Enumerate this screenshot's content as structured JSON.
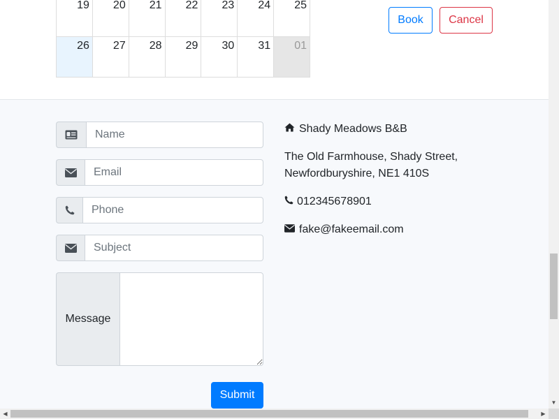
{
  "calendar": {
    "rows": [
      [
        {
          "day": "19",
          "state": "normal"
        },
        {
          "day": "20",
          "state": "normal"
        },
        {
          "day": "21",
          "state": "normal"
        },
        {
          "day": "22",
          "state": "normal"
        },
        {
          "day": "23",
          "state": "normal"
        },
        {
          "day": "24",
          "state": "normal"
        },
        {
          "day": "25",
          "state": "normal"
        }
      ],
      [
        {
          "day": "26",
          "state": "selected"
        },
        {
          "day": "27",
          "state": "normal"
        },
        {
          "day": "28",
          "state": "normal"
        },
        {
          "day": "29",
          "state": "normal"
        },
        {
          "day": "30",
          "state": "normal"
        },
        {
          "day": "31",
          "state": "normal"
        },
        {
          "day": "01",
          "state": "off-month"
        }
      ]
    ],
    "book_label": "Book",
    "cancel_label": "Cancel"
  },
  "contact_form": {
    "name_placeholder": "Name",
    "email_placeholder": "Email",
    "phone_placeholder": "Phone",
    "subject_placeholder": "Subject",
    "message_label": "Message",
    "submit_label": "Submit",
    "icons": {
      "name": "id-card-icon",
      "email": "envelope-icon",
      "phone": "phone-icon",
      "subject": "envelope-icon"
    }
  },
  "contact_info": {
    "name": "Shady Meadows B&B",
    "address_line1": "The Old Farmhouse, Shady Street,",
    "address_line2": "Newfordburyshire, NE1 410S",
    "phone": "012345678901",
    "email": "fake@fakeemail.com",
    "icons": {
      "name": "home-icon",
      "phone": "phone-icon",
      "email": "envelope-icon"
    }
  },
  "colors": {
    "primary": "#007bff",
    "danger": "#dc3545",
    "selected_day": "#e8f4fe",
    "off_month_day": "#e6e6e6",
    "section_bg": "#f7f9fc"
  }
}
